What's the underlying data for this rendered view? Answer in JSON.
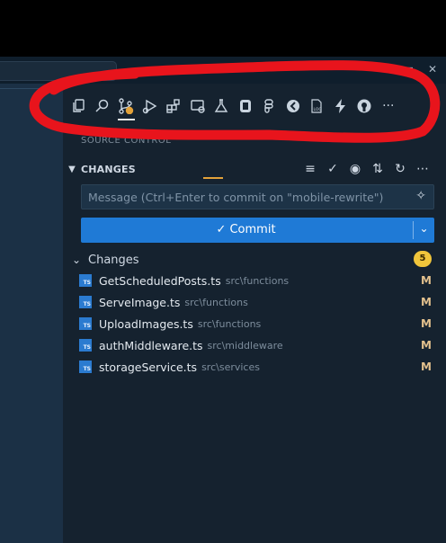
{
  "toolbar": {
    "icons": [
      "explorer-icon",
      "search-icon",
      "source-control-icon",
      "run-debug-icon",
      "extensions-icon",
      "remote-explorer-icon",
      "testing-icon",
      "database-icon",
      "figma-icon",
      "docker-icon",
      "log-icon",
      "lightning-icon",
      "github-icon",
      "more-icon"
    ],
    "more_label": "···"
  },
  "panel": {
    "section_title": "SOURCE CONTROL",
    "changes_header": "CHANGES",
    "message_placeholder": "Message (Ctrl+Enter to commit on \"mobile-rewrite\")",
    "commit_label": "✓ Commit",
    "group_label": "Changes",
    "group_count": "5",
    "files": [
      {
        "name": "GetScheduledPosts.ts",
        "path": "src\\functions",
        "status": "M",
        "icon_text": "TS"
      },
      {
        "name": "ServeImage.ts",
        "path": "src\\functions",
        "status": "M",
        "icon_text": "TS"
      },
      {
        "name": "UploadImages.ts",
        "path": "src\\functions",
        "status": "M",
        "icon_text": "TS"
      },
      {
        "name": "authMiddleware.ts",
        "path": "src\\middleware",
        "status": "M",
        "icon_text": "TS"
      },
      {
        "name": "storageService.ts",
        "path": "src\\services",
        "status": "M",
        "icon_text": "TS"
      }
    ]
  },
  "colors": {
    "accent_blue": "#1f7ad6",
    "badge_yellow": "#f0c53b",
    "modified_color": "#e2c08d",
    "annotation_red": "#e8141c"
  }
}
